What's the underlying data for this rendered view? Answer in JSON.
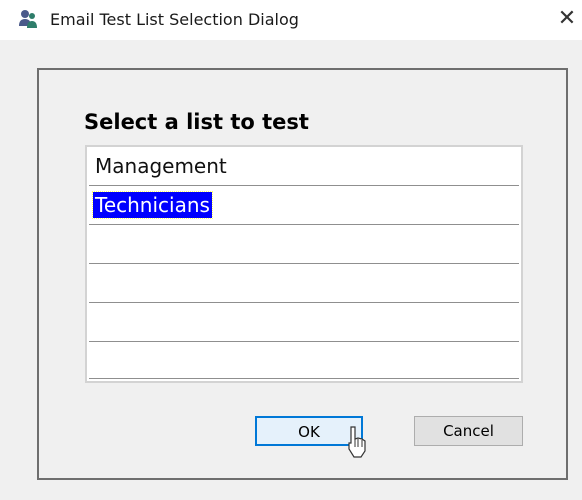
{
  "window": {
    "title": "Email Test List Selection Dialog",
    "icon": "people-icon",
    "close_glyph": "✕"
  },
  "list": {
    "heading": "Select a list to test",
    "items": [
      "Management",
      "Technicians",
      "",
      "",
      "",
      ""
    ],
    "selected_index": 1
  },
  "buttons": {
    "ok_label": "OK",
    "cancel_label": "Cancel"
  },
  "colors": {
    "selection_bg": "#0000ff",
    "ok_border": "#0078d7",
    "dialog_bg": "#f0f0f0"
  }
}
